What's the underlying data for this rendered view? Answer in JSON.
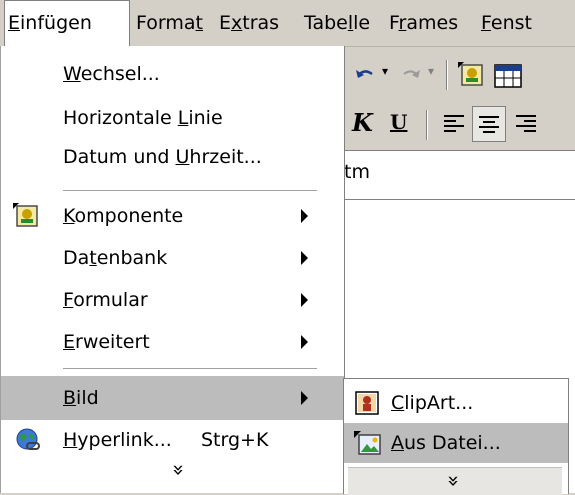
{
  "menubar": {
    "items": [
      "Einfügen",
      "Format",
      "Extras",
      "Tabelle",
      "Frames",
      "Fenst"
    ],
    "mnemonics": [
      "E",
      "t",
      "x",
      "l",
      "r",
      "F"
    ]
  },
  "toolbar": {
    "undo_icon": "undo-icon",
    "redo_icon": "redo-icon",
    "component_icon": "component-icon",
    "table_icon": "table-icon",
    "italic_label": "K",
    "underline_label": "U"
  },
  "document": {
    "fragment_text": "tm"
  },
  "menu": {
    "wechsel": {
      "before": "",
      "mn": "W",
      "after": "echsel..."
    },
    "horizontale_linie": {
      "before": "Horizontale ",
      "mn": "L",
      "after": "inie"
    },
    "datum_uhrzeit": {
      "before": "Datum und ",
      "mn": "U",
      "after": "hrzeit..."
    },
    "komponente": {
      "before": "",
      "mn": "K",
      "after": "omponente"
    },
    "datenbank": {
      "before": "Da",
      "mn": "t",
      "after": "enbank"
    },
    "formular": {
      "before": "",
      "mn": "F",
      "after": "ormular"
    },
    "erweitert": {
      "before": "",
      "mn": "E",
      "after": "rweitert"
    },
    "bild": {
      "before": "",
      "mn": "B",
      "after": "ild"
    },
    "hyperlink": {
      "before": "",
      "mn": "H",
      "after": "yperlink..."
    },
    "hyperlink_shortcut": "Strg+K",
    "expand_glyph": "»"
  },
  "submenu": {
    "clipart": {
      "before": "",
      "mn": "C",
      "after": "lipArt..."
    },
    "aus_datei": {
      "before": "",
      "mn": "A",
      "after": "us Datei..."
    },
    "expand_glyph": "»"
  },
  "colors": {
    "menu_bg": "#ffffff",
    "highlight": "#bcbcbc",
    "chrome": "#d4d0c8"
  }
}
